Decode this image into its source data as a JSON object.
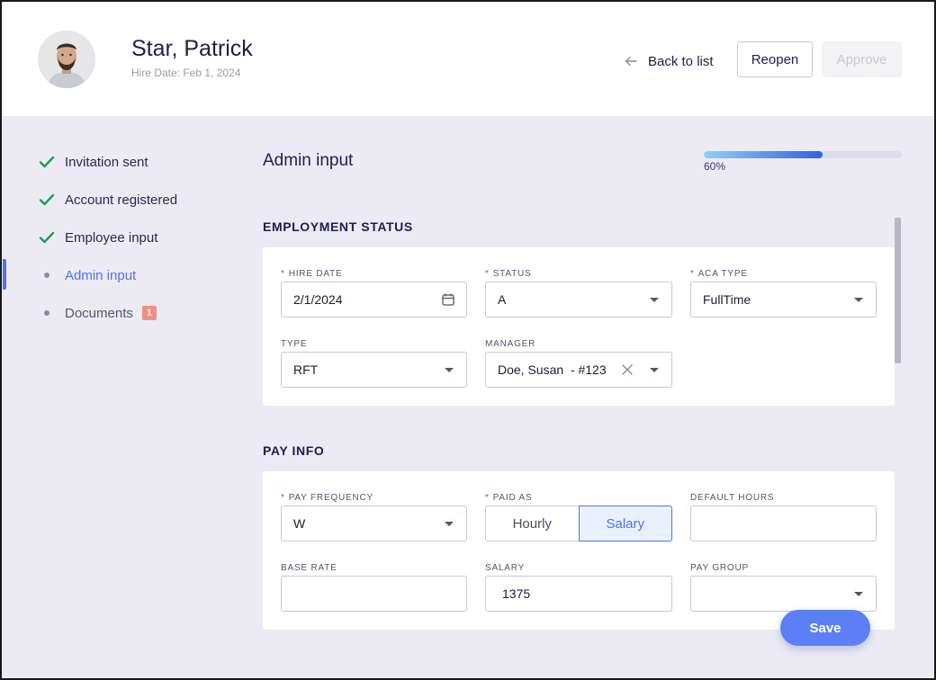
{
  "header": {
    "employee_name": "Star, Patrick",
    "hire_line": "Hire Date: Feb 1, 2024",
    "back_label": "Back to list",
    "reopen_label": "Reopen",
    "approve_label": "Approve"
  },
  "steps": [
    {
      "label": "Invitation sent",
      "state": "done"
    },
    {
      "label": "Account registered",
      "state": "done"
    },
    {
      "label": "Employee input",
      "state": "done"
    },
    {
      "label": "Admin input",
      "state": "active"
    },
    {
      "label": "Documents",
      "state": "pending",
      "badge": "1"
    }
  ],
  "main": {
    "title": "Admin input",
    "progress": {
      "percent": 60,
      "label": "60%"
    }
  },
  "employment_status": {
    "section_title": "EMPLOYMENT STATUS",
    "hire_date": {
      "label": "HIRE DATE",
      "required": true,
      "value": "2/1/2024"
    },
    "status": {
      "label": "STATUS",
      "required": true,
      "value": "A"
    },
    "aca_type": {
      "label": "ACA TYPE",
      "required": true,
      "value": "FullTime"
    },
    "type": {
      "label": "TYPE",
      "required": false,
      "value": "RFT"
    },
    "manager": {
      "label": "MANAGER",
      "required": false,
      "value": "Doe, Susan  - #123"
    }
  },
  "pay_info": {
    "section_title": "PAY INFO",
    "pay_frequency": {
      "label": "PAY FREQUENCY",
      "required": true,
      "value": "W"
    },
    "paid_as": {
      "label": "PAID AS",
      "required": true,
      "options": [
        "Hourly",
        "Salary"
      ],
      "selected": "Salary"
    },
    "default_hours": {
      "label": "DEFAULT HOURS",
      "value": ""
    },
    "base_rate": {
      "label": "BASE RATE",
      "value": ""
    },
    "salary": {
      "label": "SALARY",
      "value": "1375"
    },
    "pay_group": {
      "label": "PAY GROUP",
      "value": ""
    }
  },
  "actions": {
    "save_label": "Save"
  },
  "colors": {
    "accent": "#4b74f0",
    "check": "#1f9d55",
    "required": "#e0384f",
    "badge": "#f08f85"
  },
  "icons": {
    "done": "check-icon",
    "pending": "dot-icon",
    "back": "arrow-left-icon",
    "date": "calendar-icon",
    "clear": "close-icon",
    "dropdown": "chevron-down-icon"
  }
}
